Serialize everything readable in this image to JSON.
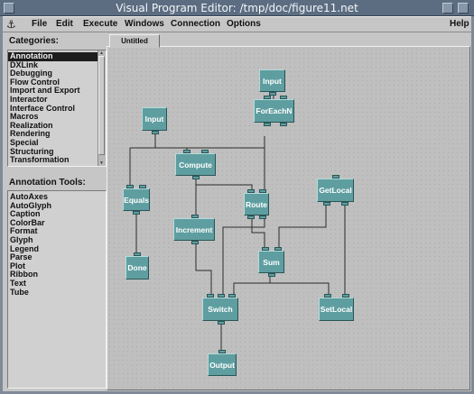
{
  "window": {
    "title": "Visual Program Editor: /tmp/doc/figure11.net"
  },
  "menu": {
    "items": [
      "File",
      "Edit",
      "Execute",
      "Windows",
      "Connection",
      "Options"
    ],
    "help": "Help"
  },
  "categories": {
    "label": "Categories:",
    "items": [
      "Annotation",
      "DXLink",
      "Debugging",
      "Flow Control",
      "Import and Export",
      "Interactor",
      "Interface Control",
      "Macros",
      "Realization",
      "Rendering",
      "Special",
      "Structuring",
      "Transformation"
    ],
    "selected": "Annotation"
  },
  "tools": {
    "label": "Annotation Tools:",
    "items": [
      "AutoAxes",
      "AutoGlyph",
      "Caption",
      "ColorBar",
      "Format",
      "Glyph",
      "Legend",
      "Parse",
      "Plot",
      "Ribbon",
      "Text",
      "Tube"
    ]
  },
  "tab": {
    "label": "Untitled"
  },
  "nodes": [
    {
      "id": "input1",
      "label": "Input"
    },
    {
      "id": "input2",
      "label": "Input"
    },
    {
      "id": "foreachn",
      "label": "ForEachN"
    },
    {
      "id": "compute",
      "label": "Compute"
    },
    {
      "id": "equals",
      "label": "Equals"
    },
    {
      "id": "getlocal",
      "label": "GetLocal"
    },
    {
      "id": "route",
      "label": "Route"
    },
    {
      "id": "increment",
      "label": "Increment"
    },
    {
      "id": "done",
      "label": "Done"
    },
    {
      "id": "sum",
      "label": "Sum"
    },
    {
      "id": "switch",
      "label": "Switch"
    },
    {
      "id": "setlocal",
      "label": "SetLocal"
    },
    {
      "id": "output",
      "label": "Output"
    }
  ]
}
